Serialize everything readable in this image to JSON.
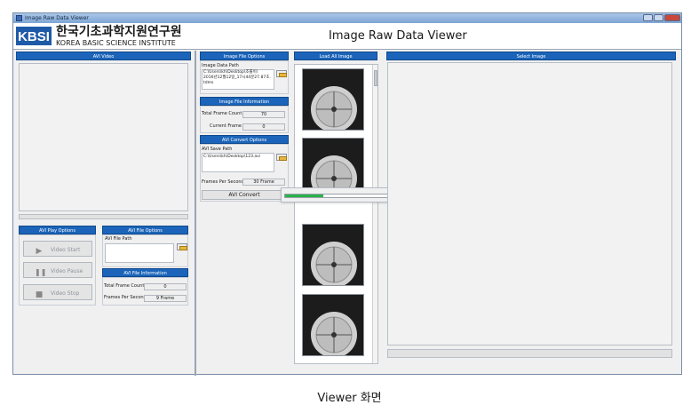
{
  "window": {
    "title": "Image Raw Data Viewer"
  },
  "header": {
    "logo_mark": "KBSI",
    "logo_korean": "한국기초과학지원연구원",
    "logo_english": "KOREA BASIC SCIENCE INSTITUTE",
    "app_title": "Image Raw Data Viewer"
  },
  "avi_video": {
    "title": "AVI Video"
  },
  "avi_play_options": {
    "title": "AVI Play Options",
    "start_label": "Video Start",
    "pause_label": "Video Pause",
    "stop_label": "Video Stop"
  },
  "avi_file_options": {
    "title": "AVI File Options",
    "path_label": "AVI File Path",
    "path_value": ""
  },
  "avi_file_information": {
    "title": "AVI File Information",
    "total_label": "Total Frame Count :",
    "total_value": "0",
    "fps_label": "Frames Per Second :",
    "fps_value": "9 Frame"
  },
  "image_file_options": {
    "title": "Image File Options",
    "path_label": "Image Data Path",
    "path_lines": [
      "C:\\Users\\kh\\Desktop\\조률이\\",
      "2016년12월12일_17시44분27.87초.",
      "tdms"
    ]
  },
  "image_file_information": {
    "title": "Image File Information",
    "total_label": "Total Frame Count :",
    "total_value": "70",
    "current_label": "Current Frame :",
    "current_value": "0"
  },
  "avi_convert_options": {
    "title": "AVI Convert Options",
    "save_label": "AVI Save Path",
    "save_value": "C:\\Users\\kh\\Desktop\\123.avi",
    "fps_label": "Frames Per Second :",
    "fps_value": "30 Frame",
    "convert_label": "AVI Convert"
  },
  "progress": {
    "fraction": 0.3
  },
  "load_all_image": {
    "title": "Load All Image"
  },
  "select_image": {
    "title": "Select Image"
  },
  "caption": "Viewer 화면",
  "colors": {
    "panel_header": "#1b64b9",
    "progress": "#2bb24c",
    "window_bg": "#f0f0f0"
  }
}
